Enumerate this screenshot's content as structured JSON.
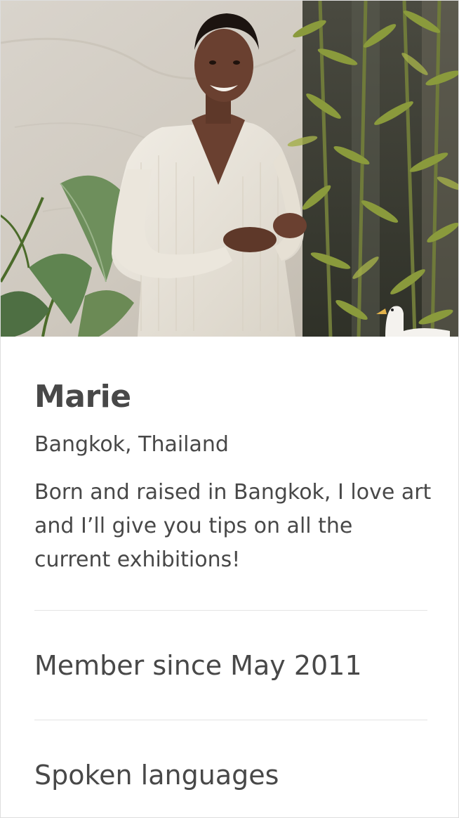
{
  "profile": {
    "name": "Marie",
    "location": "Bangkok, Thailand",
    "bio": "Born and raised in Bangkok, I love art and I’ll give you tips on all the current exhibitions!",
    "member_since": "Member since May 2011",
    "languages_heading": "Spoken languages",
    "photo_alt": "Portrait of Marie"
  },
  "icons": {
    "photo": "profile-photo"
  },
  "colors": {
    "text": "#484848",
    "divider": "#e4e4e4",
    "border": "#dedede"
  }
}
